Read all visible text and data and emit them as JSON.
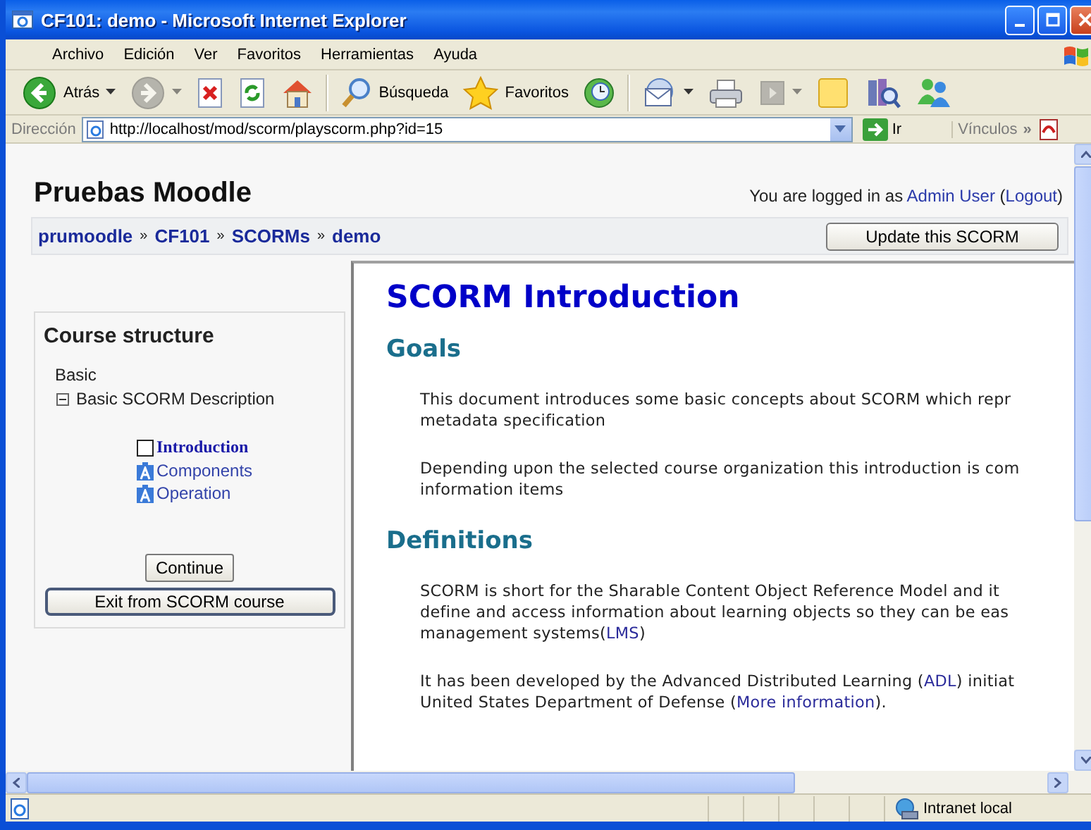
{
  "window": {
    "title": "CF101: demo - Microsoft Internet Explorer"
  },
  "menu": [
    "Archivo",
    "Edición",
    "Ver",
    "Favoritos",
    "Herramientas",
    "Ayuda"
  ],
  "toolbar": [
    [
      {
        "kind": "back",
        "label": "Atrás",
        "disabled": false,
        "dropdown": true
      },
      {
        "kind": "forward",
        "disabled": true,
        "dropdown": true
      },
      {
        "kind": "stop",
        "disabled": false,
        "dropdown": false
      },
      {
        "kind": "refresh",
        "disabled": false,
        "dropdown": false
      },
      {
        "kind": "home",
        "disabled": false,
        "dropdown": false
      }
    ],
    [
      {
        "kind": "search",
        "label": "Búsqueda",
        "disabled": false,
        "dropdown": false
      },
      {
        "kind": "favorites",
        "label": "Favoritos",
        "disabled": false,
        "dropdown": false
      },
      {
        "kind": "history",
        "disabled": false,
        "dropdown": false
      }
    ],
    [
      {
        "kind": "mail",
        "disabled": false,
        "dropdown": true
      },
      {
        "kind": "print",
        "disabled": false,
        "dropdown": false
      },
      {
        "kind": "edit",
        "disabled": true,
        "dropdown": true
      },
      {
        "kind": "note",
        "disabled": false,
        "dropdown": false
      },
      {
        "kind": "research",
        "disabled": false,
        "dropdown": false
      },
      {
        "kind": "messenger",
        "disabled": false,
        "dropdown": false
      }
    ]
  ],
  "address": {
    "label": "Dirección",
    "url": "http://localhost/mod/scorm/playscorm.php?id=15",
    "go": "Ir",
    "links": "Vínculos",
    "more": "»"
  },
  "page": {
    "site": "Pruebas Moodle",
    "login": [
      {
        "text": "You are logged in as ",
        "kind": "text"
      },
      {
        "text": "Admin User",
        "kind": "link"
      },
      {
        "text": " (",
        "kind": "text"
      },
      {
        "text": "Logout",
        "kind": "link"
      },
      {
        "text": ")",
        "kind": "text"
      }
    ],
    "breadcrumb": [
      {
        "kind": "link",
        "text": "prumoodle"
      },
      {
        "kind": "separator",
        "text": "»"
      },
      {
        "kind": "link",
        "text": "CF101"
      },
      {
        "kind": "separator",
        "text": "»"
      },
      {
        "kind": "link",
        "text": "SCORMs"
      },
      {
        "kind": "separator",
        "text": "»"
      },
      {
        "kind": "link",
        "text": "demo"
      }
    ],
    "update_button": "Update this SCORM"
  },
  "toc": {
    "title": "Course structure",
    "organization": "Basic",
    "tree": [
      {
        "text": "Basic SCORM Description",
        "expanded": true,
        "children": [
          {
            "text": "Introduction",
            "kind": "checkbox",
            "selected": true
          },
          {
            "text": "Components",
            "kind": "asset",
            "selected": false
          },
          {
            "text": "Operation",
            "kind": "asset",
            "selected": false
          }
        ]
      }
    ],
    "buttons": [
      {
        "kind": "small",
        "label": "Continue"
      },
      {
        "kind": "wide",
        "label": "Exit from SCORM course"
      }
    ]
  },
  "content": {
    "title": "SCORM Introduction",
    "sections": [
      {
        "heading": "Goals",
        "paragraphs": [
          [
            "This document introduces some basic concepts about SCORM which repr",
            "metadata specification"
          ],
          [
            "Depending upon the selected course organization this introduction is com",
            "information items"
          ]
        ]
      },
      {
        "heading": "Definitions",
        "paragraphs": [
          [
            "SCORM is short for the Sharable Content Object Reference Model and it",
            "define and access information about learning objects so they can be eas",
            [
              {
                "text": "management systems(",
                "kind": "text"
              },
              {
                "text": "LMS",
                "kind": "link"
              },
              {
                "text": ")",
                "kind": "text"
              }
            ]
          ],
          [
            [
              {
                "text": "It has been developed by the Advanced Distributed Learning (",
                "kind": "text"
              },
              {
                "text": "ADL",
                "kind": "link"
              },
              {
                "text": ") initiat",
                "kind": "text"
              }
            ],
            [
              {
                "text": "United States Department of Defense (",
                "kind": "text"
              },
              {
                "text": "More information",
                "kind": "link"
              },
              {
                "text": ").",
                "kind": "text"
              }
            ]
          ]
        ]
      }
    ]
  },
  "status_bar": {
    "zone": "Intranet local"
  }
}
